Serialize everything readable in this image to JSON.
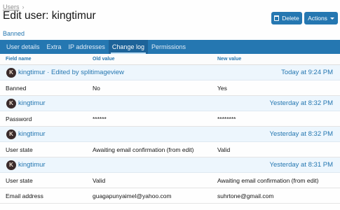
{
  "breadcrumb": {
    "items": [
      "Users"
    ],
    "separator": "›"
  },
  "title": "Edit user: kingtimur",
  "buttons": {
    "delete": "Delete",
    "actions": "Actions"
  },
  "status": "Banned",
  "tabs": [
    "User details",
    "Extra",
    "IP addresses",
    "Change log",
    "Permissions"
  ],
  "active_tab": "Change log",
  "columns": {
    "field": "Field name",
    "old": "Old value",
    "new": "New value"
  },
  "groups": [
    {
      "avatar": "K",
      "user": "kingtimur",
      "editor": " · Edited by splitimageview",
      "date": "Today at 9:24 PM",
      "rows": [
        {
          "field": "Banned",
          "old": "No",
          "new": "Yes"
        }
      ]
    },
    {
      "avatar": "K",
      "user": "kingtimur",
      "editor": "",
      "date": "Yesterday at 8:32 PM",
      "rows": [
        {
          "field": "Password",
          "old": "******",
          "new": "********"
        }
      ]
    },
    {
      "avatar": "K",
      "user": "kingtimur",
      "editor": "",
      "date": "Yesterday at 8:32 PM",
      "rows": [
        {
          "field": "User state",
          "old": "Awaiting email confirmation (from edit)",
          "new": "Valid"
        }
      ]
    },
    {
      "avatar": "K",
      "user": "kingtimur",
      "editor": "",
      "date": "Yesterday at 8:31 PM",
      "rows": [
        {
          "field": "User state",
          "old": "Valid",
          "new": "Awaiting email confirmation (from edit)"
        },
        {
          "field": "Email address",
          "old": "guagapunyaimel@yahoo.com",
          "new": "suhrtone@gmail.com"
        }
      ]
    }
  ],
  "colors": {
    "primary": "#2577b1",
    "group_bg": "#edf6fd",
    "tab_bar": "#2577b1"
  }
}
